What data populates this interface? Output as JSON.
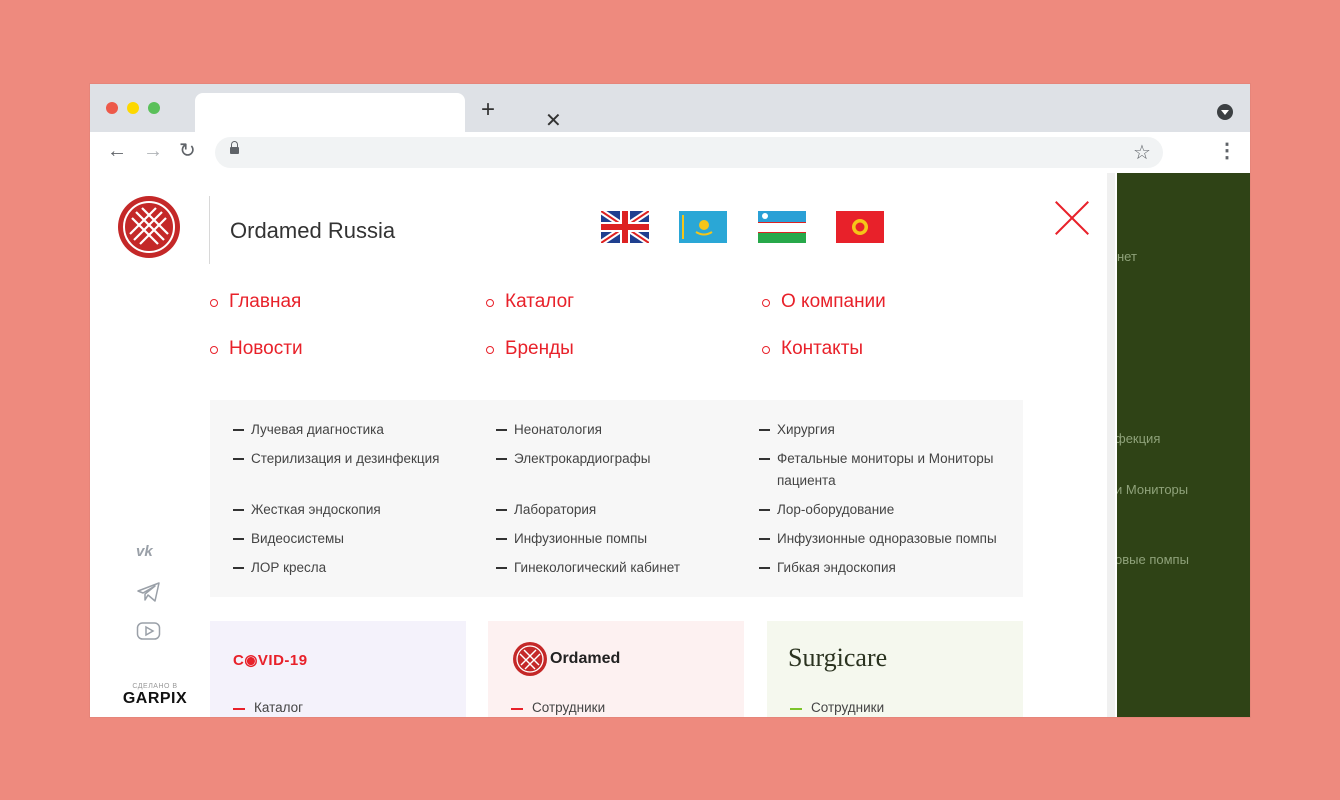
{
  "browser": {
    "address": "",
    "tab_title": ""
  },
  "header": {
    "brand": "Ordamed Russia",
    "flags": [
      "english-flag",
      "kazakhstan-flag",
      "uzbekistan-flag",
      "kyrgyzstan-flag"
    ]
  },
  "nav": {
    "items": [
      "Главная",
      "Каталог",
      "О компании",
      "Новости",
      "Бренды",
      "Контакты"
    ]
  },
  "categories": {
    "columns": [
      [
        "Лучевая диагностика",
        "Стерилизация и дезинфекция",
        "Жесткая эндоскопия",
        "Видеосистемы",
        "ЛОР кресла"
      ],
      [
        "Неонатология",
        "Электрокардиографы",
        "Лаборатория",
        "Инфузионные помпы",
        "Гинекологический кабинет"
      ],
      [
        "Хирургия",
        "Фетальные мониторы и Мониторы пациента",
        "Лор-оборудование",
        "Инфузионные одноразовые помпы",
        "Гибкая эндоскопия"
      ]
    ]
  },
  "cards": [
    {
      "logo": "C◉VID-19",
      "link": "Каталог",
      "bg": "#f4f2fb",
      "accent": "#e8212a"
    },
    {
      "logo": "Ordamed",
      "link": "Сотрудники",
      "bg": "#fdf1f1",
      "accent": "#e8212a"
    },
    {
      "logo": "Surgicare",
      "link": "Сотрудники",
      "bg": "#f5f8ee",
      "accent": "#7cc42a"
    }
  ],
  "social": [
    "vk-icon",
    "telegram-icon",
    "youtube-icon"
  ],
  "made_by": {
    "caption": "СДЕЛАНО В",
    "name": "GARPIX"
  },
  "overlay_text": [
    "нет",
    "фекция",
    "и Мониторы",
    "овые помпы"
  ],
  "colors": {
    "accent": "#e8212a",
    "overlay": "#2f4316",
    "background": "#ee8a7e"
  }
}
